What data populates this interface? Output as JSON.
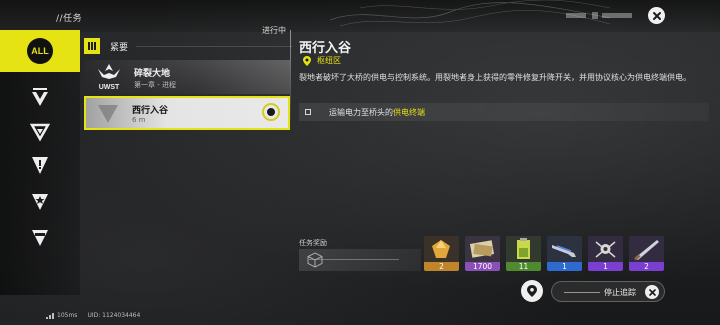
{
  "header": {
    "breadcrumb": "//任务"
  },
  "sidebar": {
    "all_label": "ALL",
    "items": [
      "main-quest-icon",
      "side-quest-icon",
      "alert-quest-icon",
      "star-quest-icon",
      "event-quest-icon"
    ]
  },
  "quest_list": {
    "status_label": "进行中",
    "category_label": "紧要",
    "quests": [
      {
        "title": "碎裂大地",
        "subtitle": "第一章 - 进程",
        "logo_text": "UWST"
      },
      {
        "title": "西行入谷",
        "subtitle": "6 m"
      }
    ]
  },
  "detail": {
    "title": "西行入谷",
    "location": "枢纽区",
    "description": "裂地者破坏了大桥的供电与控制系统。用裂地者身上获得的零件修复升降开关，并用协议核心为供电终端供电。",
    "objective_prefix": "运输电力至桥头的",
    "objective_highlight": "供电终端"
  },
  "rewards": {
    "label": "任务奖励",
    "items": [
      {
        "icon": "gold-crystal-icon",
        "count": "2",
        "color": "#c0852a"
      },
      {
        "icon": "voucher-icon",
        "count": "1700",
        "color": "#8a4fb8"
      },
      {
        "icon": "battery-icon",
        "count": "11",
        "color": "#4f8a2e"
      },
      {
        "icon": "gun-icon",
        "count": "1",
        "color": "#2e6ad0"
      },
      {
        "icon": "drone-icon",
        "count": "1",
        "color": "#7a3fd0"
      },
      {
        "icon": "blade-icon",
        "count": "2",
        "color": "#7a3fd0"
      }
    ]
  },
  "footer": {
    "stop_tracking_label": "停止追踪",
    "latency": "105ms",
    "uid": "UID: 1124034464"
  },
  "colors": {
    "accent": "#e6e314",
    "background": "#1b1c1d"
  }
}
